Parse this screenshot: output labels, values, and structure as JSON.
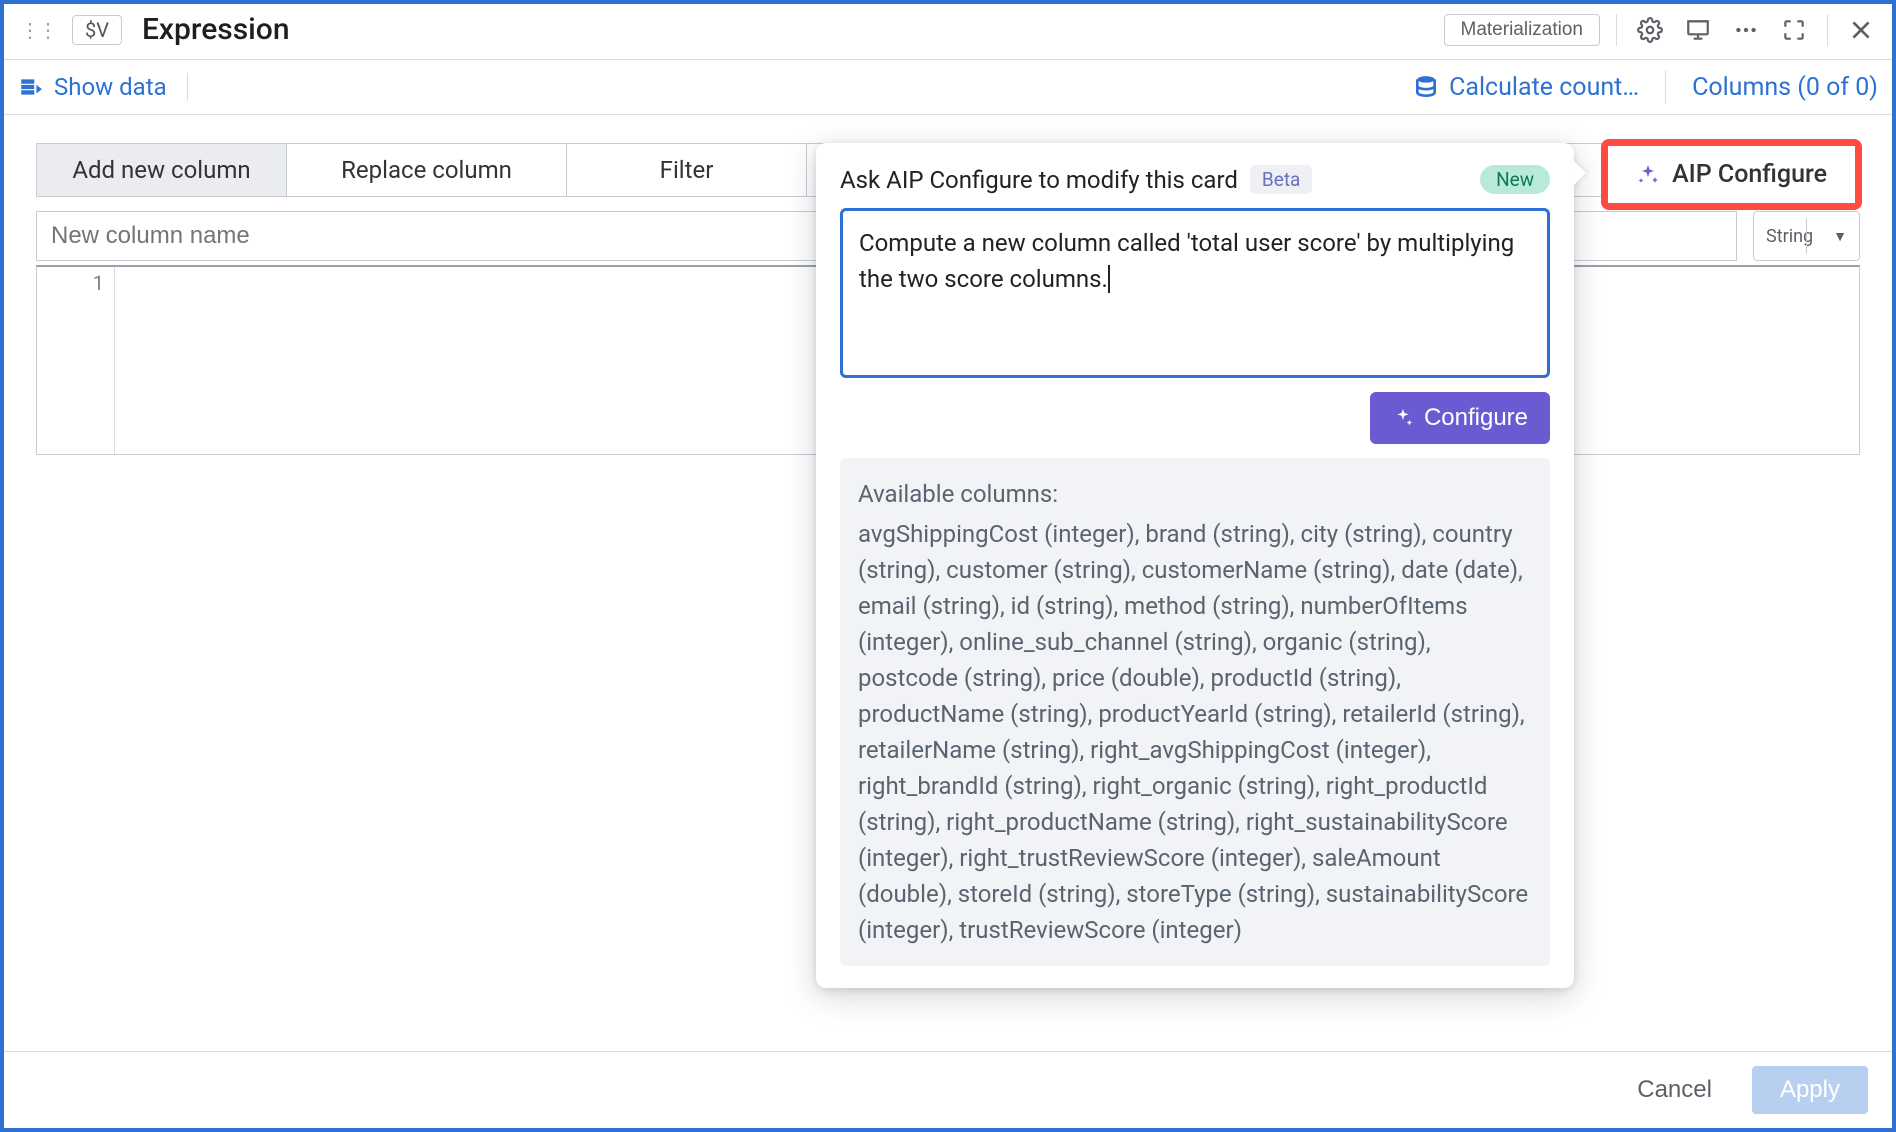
{
  "header": {
    "drag": "⋮⋮",
    "chip": "$V",
    "title": "Expression",
    "materialization": "Materialization"
  },
  "subheader": {
    "show_data": "Show data",
    "calc_counts": "Calculate count…",
    "columns": "Columns (0 of 0)"
  },
  "tabs": {
    "add": "Add new column",
    "replace": "Replace column",
    "filter": "Filter"
  },
  "inputs": {
    "new_column_placeholder": "New column name",
    "type_label": "String"
  },
  "code": {
    "line1": "1"
  },
  "aip_right": {
    "label": "AIP Configure"
  },
  "popover": {
    "title": "Ask AIP Configure to modify this card",
    "beta": "Beta",
    "new": "New",
    "prompt": "Compute a new column called 'total user score' by multiplying the two score columns.",
    "configure": "Configure",
    "available_label": "Available columns:",
    "available_columns": "avgShippingCost (integer), brand (string), city (string), country (string), customer (string), customerName (string), date (date), email (string), id (string), method (string), numberOfItems (integer), online_sub_channel (string), organic (string), postcode (string), price (double), productId (string), productName (string), productYearId (string), retailerId (string), retailerName (string), right_avgShippingCost (integer), right_brandId (string), right_organic (string), right_productId (string), right_productName (string), right_sustainabilityScore (integer), right_trustReviewScore (integer), saleAmount (double), storeId (string), storeType (string), sustainabilityScore (integer), trustReviewScore (integer)"
  },
  "footer": {
    "cancel": "Cancel",
    "apply": "Apply"
  },
  "colors": {
    "accent_blue": "#2d72d2",
    "accent_purple": "#6b5bd2",
    "highlight_red": "#ff4a3f"
  }
}
